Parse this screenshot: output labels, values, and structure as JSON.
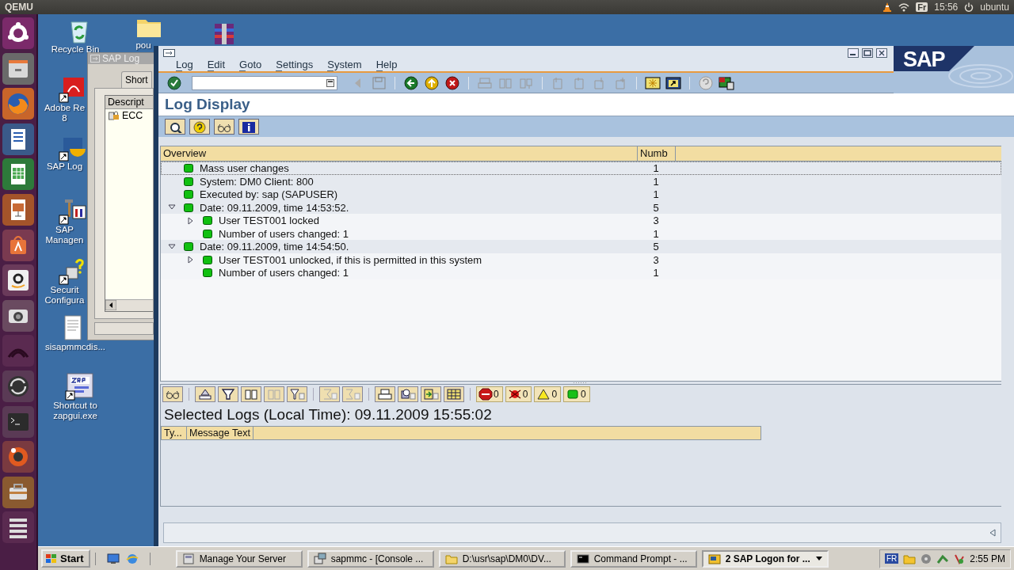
{
  "topbar": {
    "title": "QEMU",
    "keyboard": "Fr",
    "time": "15:56",
    "user": "ubuntu"
  },
  "desktop_icons": [
    {
      "kind": "recycle",
      "lines": [
        "Recycle Bin"
      ]
    },
    {
      "kind": "folder",
      "lines": [
        "pou"
      ]
    },
    {
      "kind": "archive"
    },
    {
      "kind": "pdf",
      "lines": [
        "Adobe Re",
        "8"
      ]
    },
    {
      "kind": "logon",
      "lines": [
        "SAP Log"
      ]
    },
    {
      "kind": "tools",
      "lines": [
        "SAP",
        "Managen"
      ]
    },
    {
      "kind": "security",
      "lines": [
        "Securit",
        "Configura"
      ]
    },
    {
      "kind": "document",
      "lines": [
        "sisapmmcdis..."
      ]
    },
    {
      "kind": "zrp",
      "lines": [
        "Shortcut to",
        "zapgui.exe"
      ]
    }
  ],
  "logon_window": {
    "title": "SAP Log",
    "tab": "Short",
    "column": "Descript",
    "entries": [
      "ECC"
    ]
  },
  "sap": {
    "logo": "SAP",
    "menu": [
      "Log",
      "Edit",
      "Goto",
      "Settings",
      "System",
      "Help"
    ],
    "title": "Log Display",
    "tree": {
      "columns": [
        "Overview",
        "Numb"
      ],
      "rows": [
        {
          "text": "Mass user changes",
          "count": "1",
          "selected": true
        },
        {
          "text": "System: DM0 Client: 800",
          "count": "1",
          "selected": false
        },
        {
          "text": "Executed by: sap (SAPUSER)",
          "count": "1",
          "selected": false
        },
        {
          "text": "Date: 09.11.2009, time 14:53:52.",
          "count": "5",
          "selected": false,
          "expanded": true,
          "children": [
            {
              "text": "User TEST001 locked",
              "count": "3",
              "selected": false,
              "expanded": false
            },
            {
              "text": "Number of users changed: 1",
              "count": "1",
              "selected": false
            }
          ]
        },
        {
          "text": "Date: 09.11.2009, time 14:54:50.",
          "count": "5",
          "selected": false,
          "expanded": true,
          "children": [
            {
              "text": "User TEST001 unlocked, if this is permitted in this system",
              "count": "3",
              "selected": false,
              "expanded": false
            },
            {
              "text": "Number of users changed: 1",
              "count": "1",
              "selected": false
            }
          ]
        }
      ]
    },
    "counters": [
      {
        "kind": "stop",
        "count": "0"
      },
      {
        "kind": "error",
        "count": "0"
      },
      {
        "kind": "warning",
        "count": "0"
      },
      {
        "kind": "success",
        "count": "0"
      }
    ],
    "logs_heading": "Selected Logs (Local Time): 09.11.2009 15:55:02",
    "messages": {
      "columns": [
        "Ty...",
        "Message Text"
      ]
    }
  },
  "taskbar": {
    "start": "Start",
    "tasks": [
      {
        "kind": "server",
        "label": "Manage Your Server",
        "selected": false
      },
      {
        "kind": "console",
        "label": "sapmmc - [Console ...",
        "selected": false
      },
      {
        "kind": "folder",
        "label": "D:\\usr\\sap\\DM0\\DV...",
        "selected": false
      },
      {
        "kind": "cmd",
        "label": "Command Prompt - ...",
        "selected": false
      },
      {
        "kind": "logon",
        "label": "2 SAP Logon for ...",
        "selected": true
      }
    ],
    "keyboard": "FR",
    "clock": "2:55 PM"
  }
}
